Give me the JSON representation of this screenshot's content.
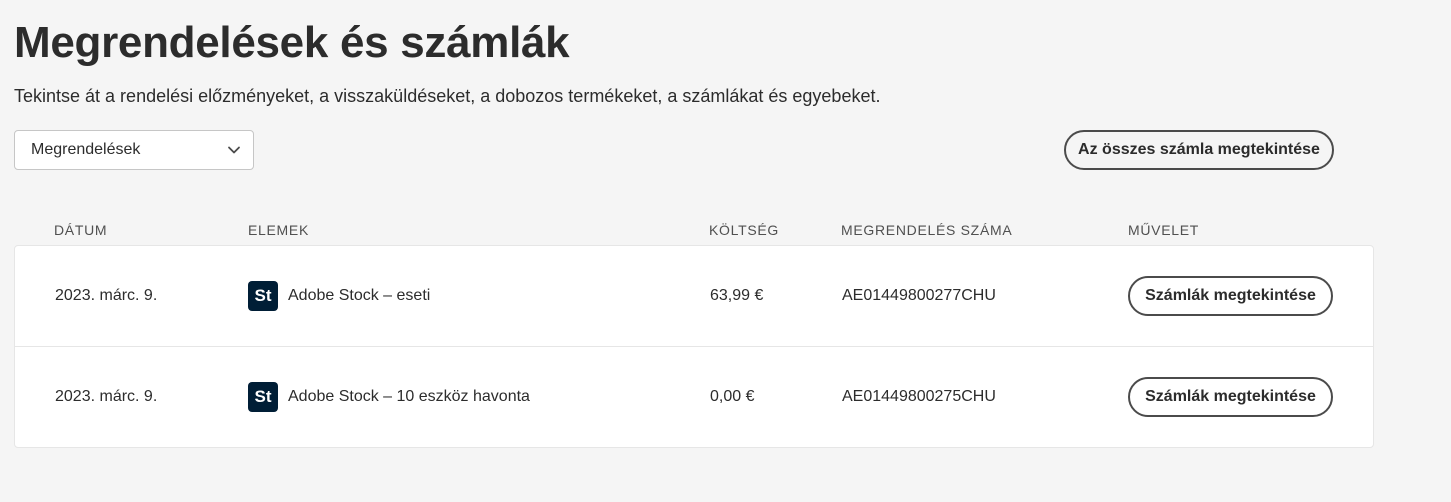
{
  "header": {
    "title": "Megrendelések és számlák",
    "subtitle": "Tekintse át a rendelési előzményeket, a visszaküldéseket, a dobozos termékeket, a számlákat és egyebeket."
  },
  "filter": {
    "selected": "Megrendelések",
    "icon": "chevron-down-icon"
  },
  "view_all_button": "Az összes számla megtekintése",
  "table": {
    "columns": {
      "date": "DÁTUM",
      "items": "ELEMEK",
      "cost": "KÖLTSÉG",
      "order_number": "MEGRENDELÉS SZÁMA",
      "action": "MŰVELET"
    },
    "rows": [
      {
        "date": "2023. márc. 9.",
        "product_badge": "St",
        "item": "Adobe Stock – eseti",
        "cost": "63,99 €",
        "order_number": "AE01449800277CHU",
        "action": "Számlák megtekintése"
      },
      {
        "date": "2023. márc. 9.",
        "product_badge": "St",
        "item": "Adobe Stock – 10 eszköz havonta",
        "cost": "0,00 €",
        "order_number": "AE01449800275CHU",
        "action": "Számlák megtekintése"
      }
    ]
  },
  "colors": {
    "background": "#f5f5f5",
    "stock_badge": "#001e36",
    "text": "#2c2c2c"
  }
}
